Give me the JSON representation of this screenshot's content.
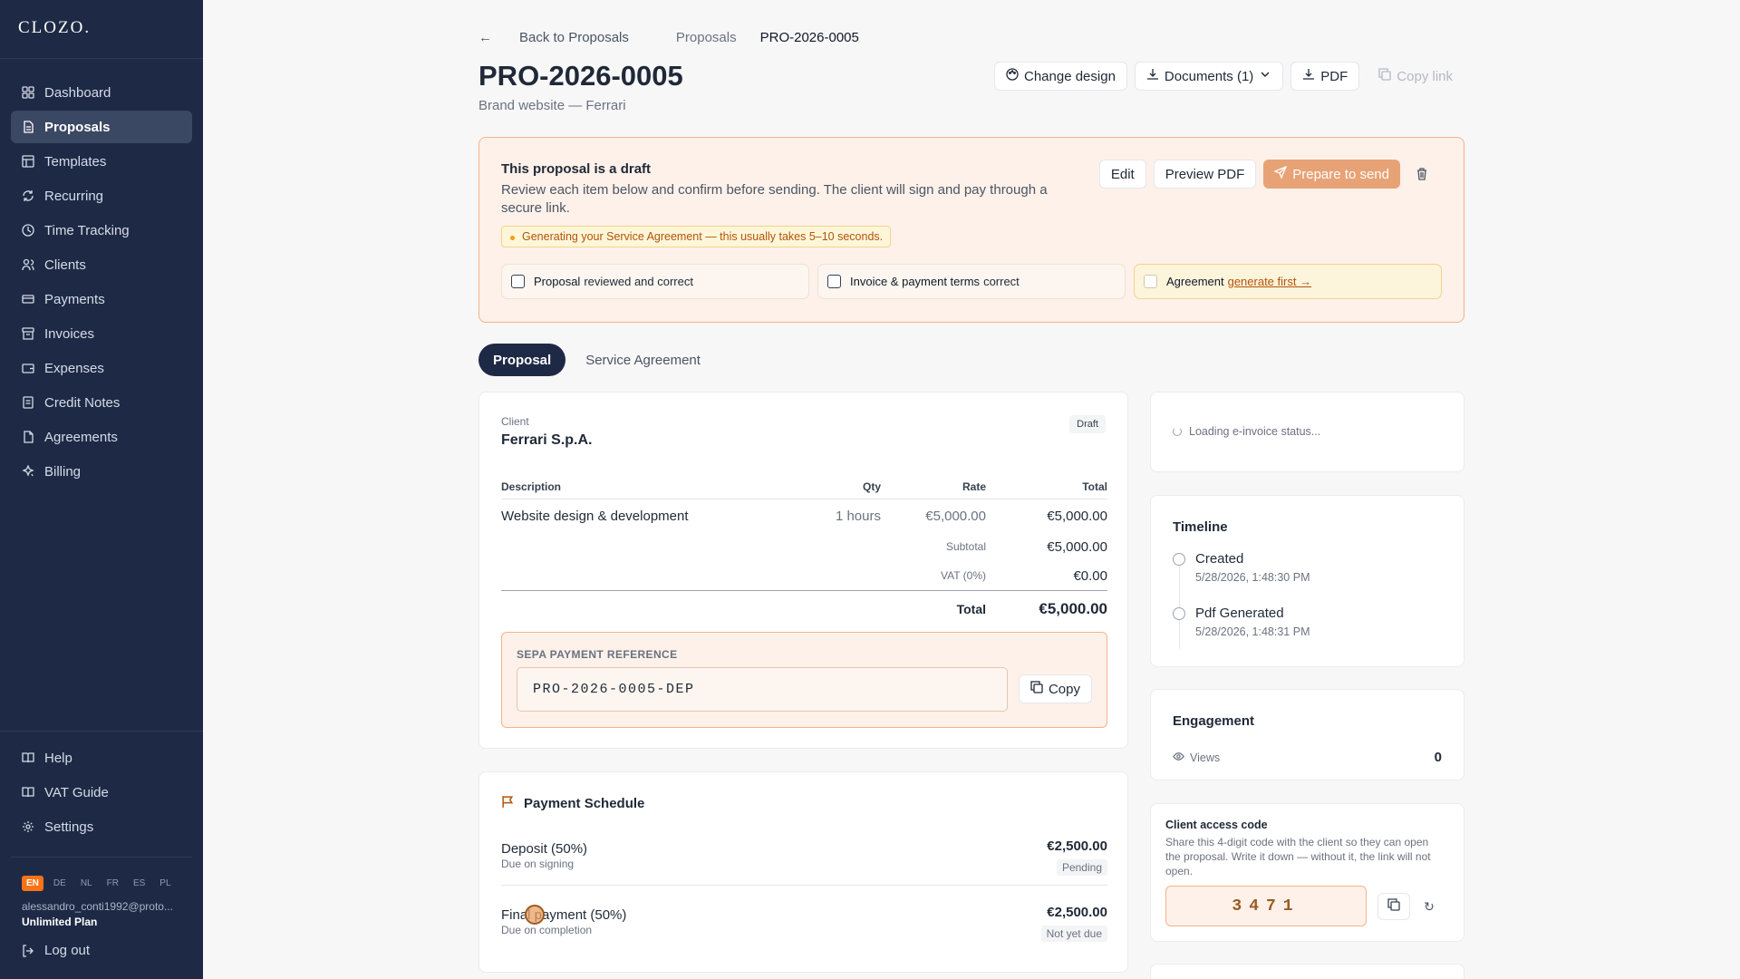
{
  "brand": "CLOZO.",
  "sidebar": {
    "items": [
      {
        "label": "Dashboard",
        "icon": "dashboard-icon"
      },
      {
        "label": "Proposals",
        "icon": "document-icon"
      },
      {
        "label": "Templates",
        "icon": "template-icon"
      },
      {
        "label": "Recurring",
        "icon": "recurring-icon"
      },
      {
        "label": "Time Tracking",
        "icon": "clock-icon"
      },
      {
        "label": "Clients",
        "icon": "users-icon"
      },
      {
        "label": "Payments",
        "icon": "card-icon"
      },
      {
        "label": "Invoices",
        "icon": "invoice-icon"
      },
      {
        "label": "Expenses",
        "icon": "wallet-icon"
      },
      {
        "label": "Credit Notes",
        "icon": "credit-note-icon"
      },
      {
        "label": "Agreements",
        "icon": "agreement-icon"
      },
      {
        "label": "Billing",
        "icon": "billing-icon"
      }
    ],
    "active": "Proposals",
    "bottom_items": [
      {
        "label": "Help",
        "icon": "book-icon"
      },
      {
        "label": "VAT Guide",
        "icon": "book-icon"
      },
      {
        "label": "Settings",
        "icon": "gear-icon"
      }
    ],
    "languages": [
      "EN",
      "DE",
      "NL",
      "FR",
      "ES",
      "PL"
    ],
    "active_language": "EN",
    "user_email": "alessandro_conti1992@proto...",
    "plan": "Unlimited Plan",
    "logout": "Log out"
  },
  "breadcrumb": {
    "back": "Back to Proposals",
    "parent": "Proposals",
    "current": "PRO-2026-0005"
  },
  "header": {
    "title": "PRO-2026-0005",
    "subtitle": "Brand website — Ferrari",
    "change_design": "Change design",
    "documents": "Documents (1)",
    "pdf": "PDF",
    "copy_link": "Copy link"
  },
  "draft": {
    "title": "This proposal is a draft",
    "text": "Review each item below and confirm before sending. The client will sign and pay through a secure link.",
    "notice": "Generating your Service Agreement — this usually takes 5–10 seconds.",
    "edit": "Edit",
    "preview_pdf": "Preview PDF",
    "prepare": "Prepare to send",
    "checks": [
      {
        "bold": "Proposal",
        "text": "reviewed and correct"
      },
      {
        "bold": "Invoice & payment terms",
        "text": "correct"
      },
      {
        "bold": "Agreement",
        "link": "generate first →"
      }
    ]
  },
  "tabs": [
    "Proposal",
    "Service Agreement"
  ],
  "proposal": {
    "client_label": "Client",
    "client_name": "Ferrari S.p.A.",
    "status": "Draft",
    "columns": [
      "Description",
      "Qty",
      "Rate",
      "Total"
    ],
    "items": [
      {
        "description": "Website design & development",
        "qty": "1 hours",
        "rate": "€5,000.00",
        "total": "€5,000.00"
      }
    ],
    "subtotal_label": "Subtotal",
    "subtotal": "€5,000.00",
    "vat_label": "VAT (0%)",
    "vat": "€0.00",
    "total_label": "Total",
    "total": "€5,000.00",
    "sepa_label": "SEPA PAYMENT REFERENCE",
    "sepa_reference": "PRO-2026-0005-DEP",
    "copy": "Copy"
  },
  "schedule": {
    "title": "Payment Schedule",
    "rows": [
      {
        "name": "Deposit (50%)",
        "due": "Due on signing",
        "amount": "€2,500.00",
        "status": "Pending"
      },
      {
        "name": "Final payment (50%)",
        "due": "Due on completion",
        "amount": "€2,500.00",
        "status": "Not yet due"
      }
    ]
  },
  "einvoice": {
    "status": "Loading e-invoice status..."
  },
  "timeline": {
    "title": "Timeline",
    "events": [
      {
        "label": "Created",
        "time": "5/28/2026, 1:48:30 PM"
      },
      {
        "label": "Pdf Generated",
        "time": "5/28/2026, 1:48:31 PM"
      }
    ]
  },
  "engagement": {
    "title": "Engagement",
    "views_label": "Views",
    "views": "0"
  },
  "access": {
    "title": "Client access code",
    "text": "Share this 4-digit code with the client so they can open the proposal. Write it down — without it, the link will not open.",
    "code": "3471"
  },
  "colors": {
    "sidebar": "#1e2a45",
    "accent": "#f97316",
    "draft_bg": "#fdf1e9",
    "draft_border": "#f4b48a"
  }
}
